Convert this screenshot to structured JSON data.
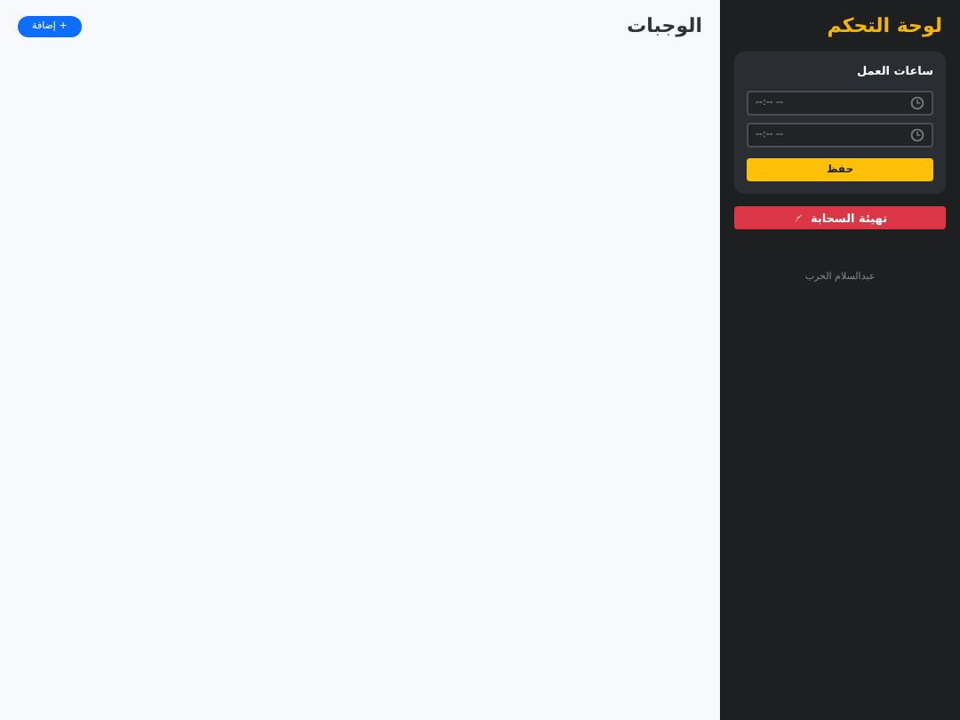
{
  "sidebar": {
    "title": "لوحة التحكم",
    "work_hours": {
      "heading": "ساعات العمل",
      "fields": [
        {
          "value": "--:-- --"
        },
        {
          "value": "--:-- --"
        }
      ],
      "save_button": "حفظ"
    },
    "cloud_button": "تهيئة السحابة",
    "footer": "عبدالسلام الحرب"
  },
  "main": {
    "title": "الوجبات",
    "add_button": "+ إضافة"
  }
}
